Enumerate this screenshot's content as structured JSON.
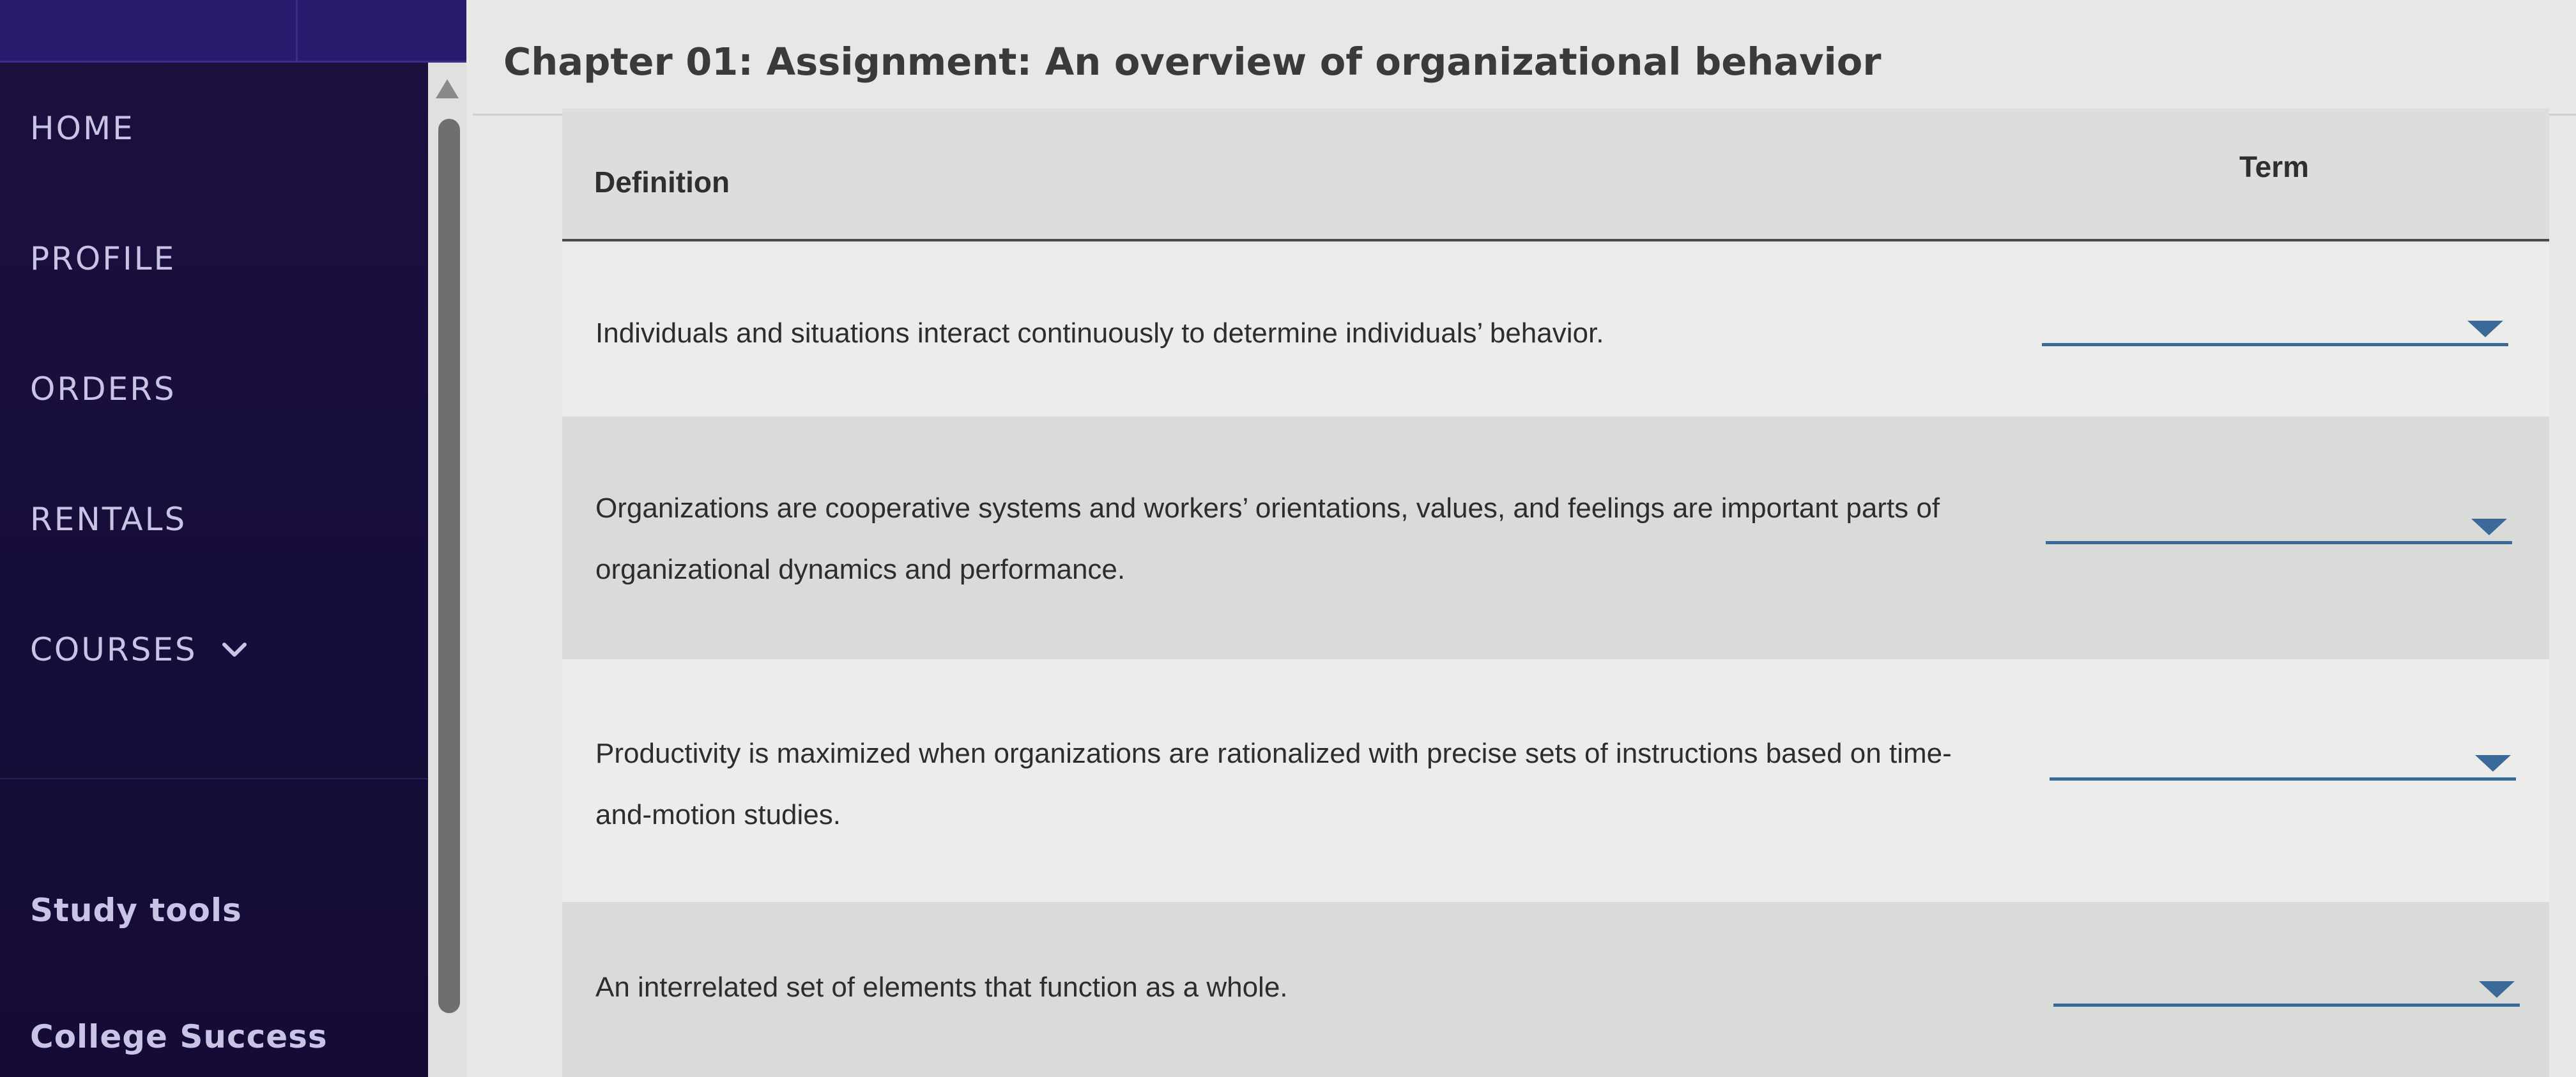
{
  "sidebar": {
    "nav": [
      {
        "label": "HOME"
      },
      {
        "label": "PROFILE"
      },
      {
        "label": "ORDERS"
      },
      {
        "label": "RENTALS"
      },
      {
        "label": "COURSES"
      }
    ],
    "tools": [
      {
        "label": "Study tools"
      },
      {
        "label": "College Success"
      }
    ],
    "icons": {
      "courses_toggle": "chevron-down-icon",
      "scroll_up": "triangle-up-icon"
    }
  },
  "main": {
    "title": "Chapter 01: Assignment: An overview of organizational behavior",
    "table": {
      "headers": {
        "definition": "Definition",
        "term": "Term"
      },
      "rows": [
        {
          "definition": "Individuals and situations interact continuously to determine individuals’ behavior.",
          "term": ""
        },
        {
          "definition": "Organizations are cooperative systems and workers’ orientations, values, and feelings are important parts of organizational dynamics and performance.",
          "term": ""
        },
        {
          "definition": "Productivity is maximized when organizations are rationalized with precise sets of instructions based on time-and-motion studies.",
          "term": ""
        },
        {
          "definition": "An interrelated set of elements that function as a whole.",
          "term": ""
        }
      ]
    }
  },
  "colors": {
    "sidebar_bg": "#170d3a",
    "topbar_bg": "#2a1a6e",
    "accent_line": "#3b6a9a",
    "row_light": "#ecedea",
    "row_dark": "#d9dbd8"
  }
}
